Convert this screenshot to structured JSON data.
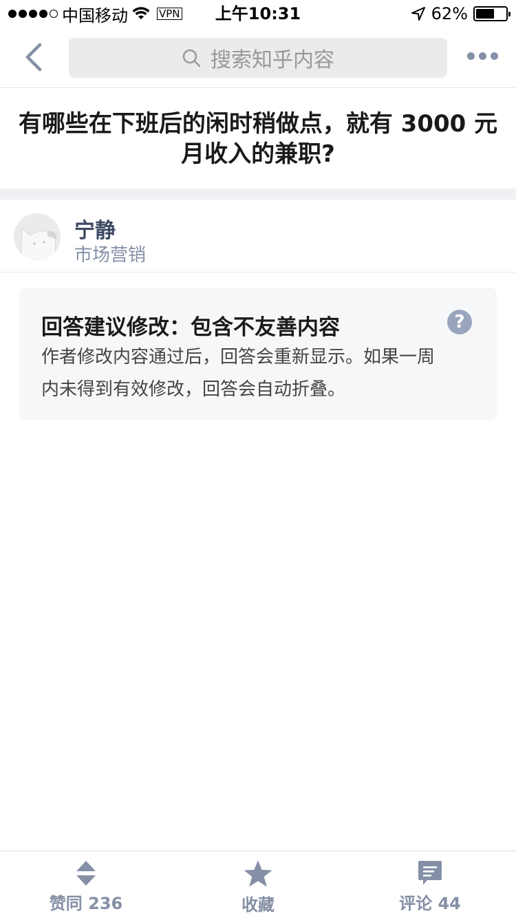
{
  "status_bar": {
    "carrier": "中国移动",
    "vpn": "VPN",
    "time": "上午10:31",
    "battery_text": "62%",
    "battery_level": 0.62
  },
  "nav": {
    "search_placeholder": "搜索知乎内容"
  },
  "question": {
    "title": "有哪些在下班后的闲时稍做点，就有 3000 元月收入的兼职?"
  },
  "author": {
    "name": "宁静",
    "headline": "市场营销"
  },
  "notice": {
    "title": "回答建议修改：包含不友善内容",
    "help_symbol": "?",
    "body": "作者修改内容通过后，回答会重新显示。如果一周内未得到有效修改，回答会自动折叠。"
  },
  "bottom_bar": {
    "vote_label": "赞同 236",
    "collect_label": "收藏",
    "comment_label": "评论 44"
  },
  "colors": {
    "accent_gray": "#8590a6",
    "card_bg": "#f6f7f9",
    "divider_bg": "#f0f1f5"
  },
  "icons": [
    "back-chevron-icon",
    "search-icon",
    "more-icon",
    "help-icon",
    "vote-icon",
    "star-icon",
    "comment-icon",
    "wifi-icon",
    "location-arrow-icon",
    "battery-icon"
  ]
}
